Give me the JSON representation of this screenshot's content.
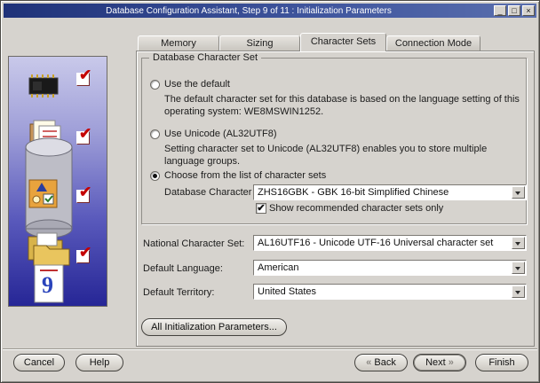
{
  "window": {
    "title": "Database Configuration Assistant, Step 9 of 11 : Initialization Parameters",
    "controls": {
      "minimize": "_",
      "maximize": "□",
      "close": "×"
    }
  },
  "colors": {
    "background": "#d6d3ce",
    "titlebar": "#1f3279",
    "side_panel_top": "#c9c9ea",
    "side_panel_bottom": "#262696",
    "check_red": "#c40000"
  },
  "icons": {
    "check": "✔",
    "combo_arrow": "▼"
  },
  "tabs": [
    {
      "label": "Memory",
      "active": false
    },
    {
      "label": "Sizing",
      "active": false
    },
    {
      "label": "Character Sets",
      "active": true
    },
    {
      "label": "Connection Mode",
      "active": false
    }
  ],
  "charset_group": {
    "title": "Database Character Set",
    "radio_default": {
      "label": "Use the default",
      "selected": false,
      "description": "The default character set for this database is based on the language setting of this operating system: WE8MSWIN1252."
    },
    "radio_unicode": {
      "label": "Use Unicode (AL32UTF8)",
      "selected": false,
      "description": "Setting character set to Unicode (AL32UTF8) enables you to store multiple language groups."
    },
    "radio_choose": {
      "label": "Choose from the list of character sets",
      "selected": true
    },
    "db_charset": {
      "label": "Database Character Set:",
      "value": "ZHS16GBK - GBK 16-bit Simplified Chinese"
    },
    "show_recommended": {
      "label": "Show recommended character sets only",
      "checked": true
    }
  },
  "fields": [
    {
      "label": "National Character Set:",
      "value": "AL16UTF16 - Unicode UTF-16 Universal character set"
    },
    {
      "label": "Default Language:",
      "value": "American"
    },
    {
      "label": "Default Territory:",
      "value": "United States"
    }
  ],
  "buttons": {
    "all_init": "All Initialization Parameters...",
    "cancel": "Cancel",
    "help": "Help",
    "back": "Back",
    "next": "Next",
    "finish": "Finish",
    "back_chevron": "«",
    "next_chevron": "»"
  }
}
